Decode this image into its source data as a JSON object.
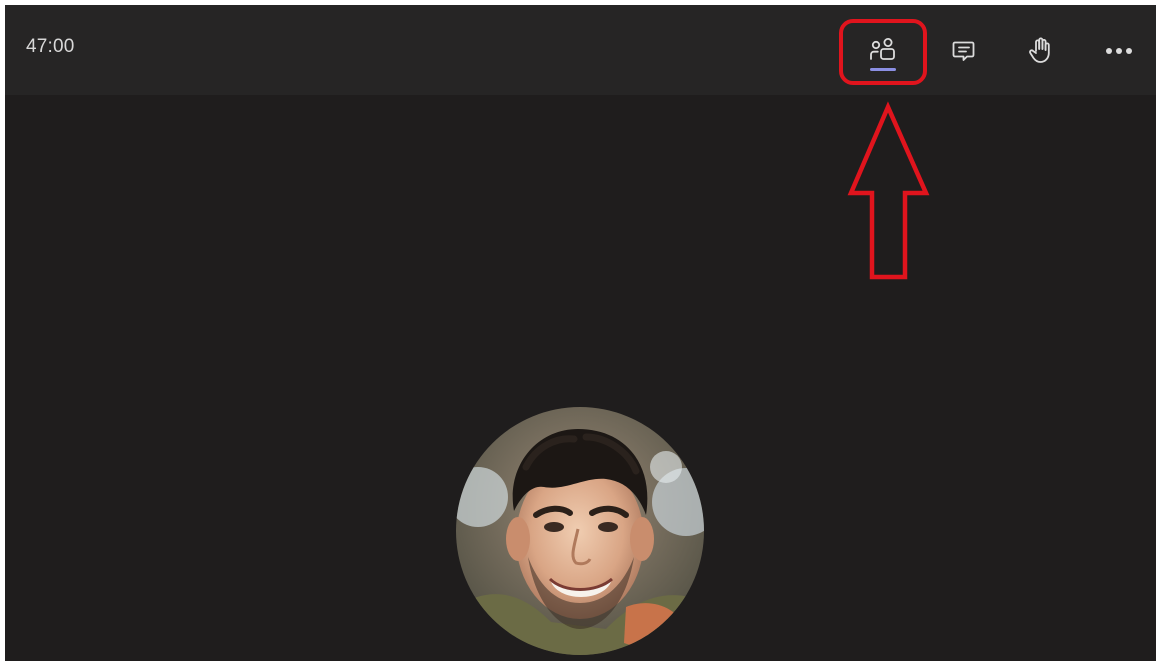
{
  "meeting": {
    "timer": "47:00"
  },
  "toolbar": {
    "buttons": [
      {
        "icon": "people-icon",
        "active": true
      },
      {
        "icon": "chat-icon",
        "active": false
      },
      {
        "icon": "raise-hand-icon",
        "active": false
      },
      {
        "icon": "more-options-icon",
        "active": false
      }
    ]
  },
  "participant": {
    "avatar": "participant-photo"
  },
  "annotation": {
    "target": "people-button",
    "shape": "rounded-rectangle-and-up-arrow"
  },
  "colors": {
    "background": "#1f1d1d",
    "topbar": "#262525",
    "icon": "#dcdcdc",
    "accent": "#8b8fe3",
    "annotation": "#e0141d"
  }
}
